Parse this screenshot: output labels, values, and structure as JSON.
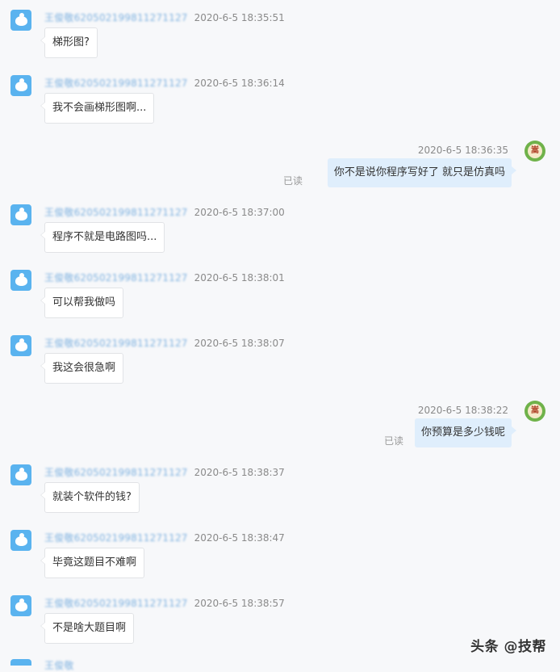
{
  "messages": [
    {
      "side": "left",
      "sender": "王俊敬620502199811271127",
      "time": "2020-6-5 18:35:51",
      "text": "梯形图?"
    },
    {
      "side": "left",
      "sender": "王俊敬620502199811271127",
      "time": "2020-6-5 18:36:14",
      "text": "我不会画梯形图啊..."
    },
    {
      "side": "right",
      "time": "2020-6-5 18:36:35",
      "text": "你不是说你程序写好了   就只是仿真吗",
      "read": "已读",
      "avatar_text": "嵩"
    },
    {
      "side": "left",
      "sender": "王俊敬620502199811271127",
      "time": "2020-6-5 18:37:00",
      "text": "程序不就是电路图吗..."
    },
    {
      "side": "left",
      "sender": "王俊敬620502199811271127",
      "time": "2020-6-5 18:38:01",
      "text": "可以帮我做吗"
    },
    {
      "side": "left",
      "sender": "王俊敬620502199811271127",
      "time": "2020-6-5 18:38:07",
      "text": "我这会很急啊"
    },
    {
      "side": "right",
      "time": "2020-6-5 18:38:22",
      "text": "你预算是多少钱呢",
      "read": "已读",
      "avatar_text": "嵩"
    },
    {
      "side": "left",
      "sender": "王俊敬620502199811271127",
      "time": "2020-6-5 18:38:37",
      "text": "就装个软件的钱?"
    },
    {
      "side": "left",
      "sender": "王俊敬620502199811271127",
      "time": "2020-6-5 18:38:47",
      "text": "毕竟这题目不难啊"
    },
    {
      "side": "left",
      "sender": "王俊敬620502199811271127",
      "time": "2020-6-5 18:38:57",
      "text": "不是啥大题目啊"
    }
  ],
  "partial_sender": "王俊敬",
  "watermark": "头条 @技帮",
  "colors": {
    "background": "#f7f8fa",
    "bubble_self": "#dfeefc",
    "bubble_other": "#ffffff",
    "avatar_other": "#5ab3ef",
    "avatar_self": "#6fb24a"
  }
}
